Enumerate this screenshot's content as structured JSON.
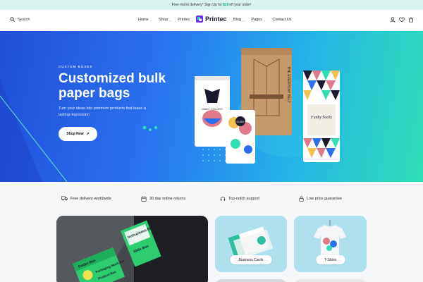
{
  "announcement": {
    "prefix": "Free metro delivery* Sign Up for",
    "amount": "$10",
    "suffix": "off your order!"
  },
  "header": {
    "search_label": "Search",
    "nav_left": [
      {
        "label": "Home",
        "dropdown": true
      },
      {
        "label": "Shop",
        "dropdown": true
      },
      {
        "label": "Printec",
        "dropdown": true
      }
    ],
    "logo_text": "Printec",
    "nav_right": [
      {
        "label": "Blog",
        "dropdown": true
      },
      {
        "label": "Pages",
        "dropdown": true
      },
      {
        "label": "Contact Us",
        "dropdown": false
      }
    ],
    "icons": [
      "user-icon",
      "heart-icon",
      "cart-icon"
    ]
  },
  "hero": {
    "eyebrow": "CUSTOM BOXES",
    "title": "Customized bulk paper bags",
    "description": "Turn your ideas into premium products that leave a lasting impression",
    "cta_label": "Shop Now",
    "product_texts": {
      "belt_bag": "THE EVERYDAY BELT",
      "pouch_left": "MANY COLORS",
      "pouch_small": "GUIDE",
      "patterned_bag": "Funky Socks"
    }
  },
  "features": [
    {
      "icon": "truck-icon",
      "label": "Free delivery worldwide"
    },
    {
      "icon": "calendar-icon",
      "label": "30 day online returns"
    },
    {
      "icon": "headset-icon",
      "label": "Top-notch support"
    },
    {
      "icon": "lock-icon",
      "label": "Low price guarantee"
    }
  ],
  "cards": {
    "featured_box_texts": [
      "Folder Box",
      "Instructions Book",
      "Slide Box",
      "Packaging Mock Set",
      "Product Box"
    ],
    "business_cards": "Business Cards",
    "tshirts": "T-Shirts"
  },
  "colors": {
    "accent": "#12a38a",
    "hero_start": "#1f4fd8",
    "hero_end": "#2fe0b5"
  }
}
